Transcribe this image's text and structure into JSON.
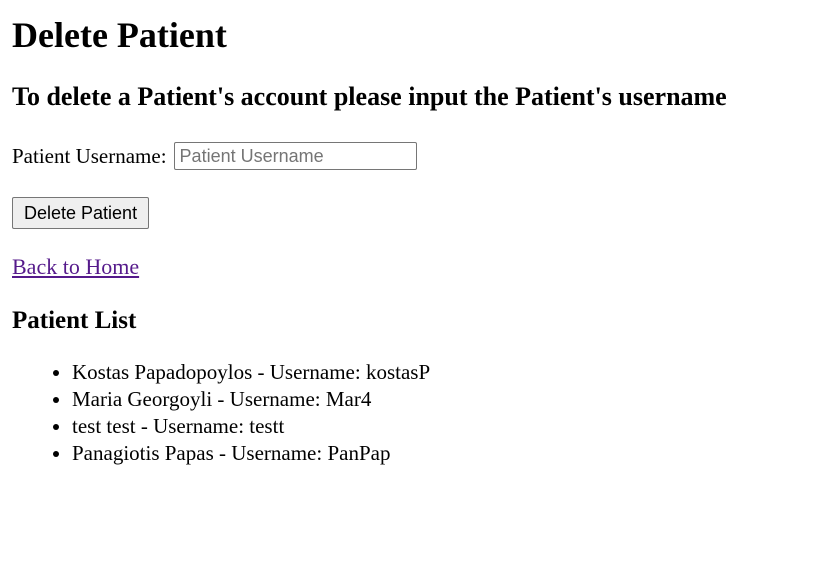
{
  "page": {
    "title": "Delete Patient",
    "subtitle": "To delete a Patient's account please input the Patient's username"
  },
  "form": {
    "username_label": "Patient Username:",
    "username_placeholder": "Patient Username",
    "username_value": "",
    "submit_label": "Delete Patient"
  },
  "nav": {
    "back_home_label": "Back to Home"
  },
  "patients": {
    "heading": "Patient List",
    "items": [
      "Kostas Papadopoylos - Username: kostasP",
      "Maria Georgoyli - Username: Mar4",
      "test test - Username: testt",
      "Panagiotis Papas - Username: PanPap"
    ]
  },
  "colors": {
    "link_visited": "#551a8b",
    "button_bg": "#efefef",
    "input_border": "#767676"
  }
}
